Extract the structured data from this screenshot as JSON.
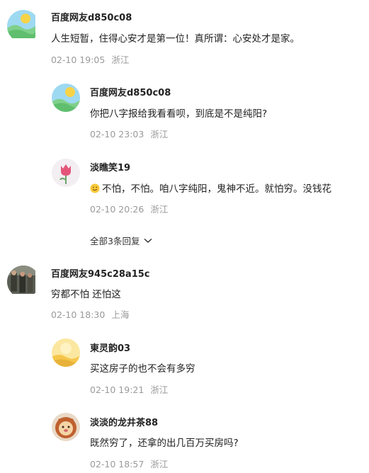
{
  "comments": [
    {
      "username": "百度网友d850c08",
      "text": "人生短暂，住得心安才是第一位！真所谓：心安处才是家。",
      "time": "02-10 19:05",
      "location": "浙江",
      "avatar": "landscape-sun-avatar"
    },
    {
      "username": "百度网友d850c08",
      "text": "你把八字报给我看看呗，到底是不是纯阳?",
      "time": "02-10 23:03",
      "location": "浙江",
      "avatar": "landscape-sun-avatar"
    },
    {
      "username": "淡瞧笑19",
      "text": "不怕，不怕。咱八字纯阳，鬼神不近。就怕穷。没钱花",
      "time": "02-10 20:26",
      "location": "浙江",
      "avatar": "tulip-avatar"
    },
    {
      "username": "百度网友945c28a15c",
      "text": "穷都不怕 还怕这",
      "time": "02-10 18:30",
      "location": "上海",
      "avatar": "photo-avatar"
    },
    {
      "username": "東灵韵03",
      "text": "买这房子的也不会有多穷",
      "time": "02-10 19:21",
      "location": "浙江",
      "avatar": "yellow-landscape-avatar"
    },
    {
      "username": "淡淡的龙井茶88",
      "text": "既然穷了，还拿的出几百万买房吗?",
      "time": "02-10 18:57",
      "location": "浙江",
      "avatar": "lion-avatar"
    }
  ],
  "expand_replies": {
    "label": "全部3条回复",
    "icon": "chevron-down-icon"
  }
}
